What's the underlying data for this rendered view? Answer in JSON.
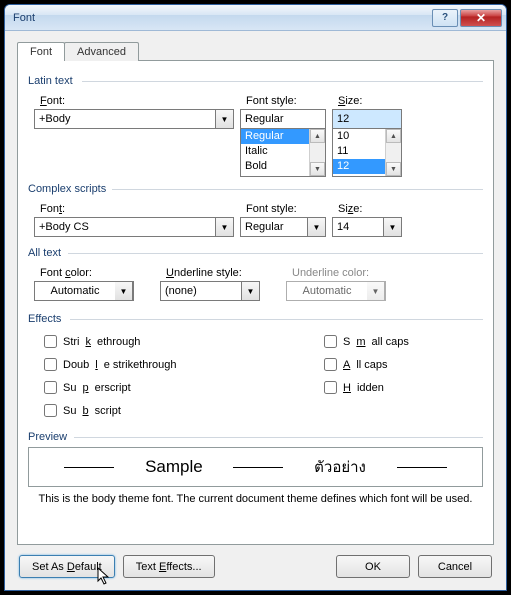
{
  "title": "Font",
  "tabs": {
    "font": "Font",
    "advanced": "Advanced"
  },
  "latin": {
    "section": "Latin text",
    "font_label": "Font:",
    "font_value": "+Body",
    "style_label": "Font style:",
    "style_value": "Regular",
    "style_options": [
      "Regular",
      "Italic",
      "Bold"
    ],
    "size_label": "Size:",
    "size_value": "12",
    "size_options": [
      "10",
      "11",
      "12"
    ]
  },
  "complex": {
    "section": "Complex scripts",
    "font_label": "Font:",
    "font_value": "+Body CS",
    "style_label": "Font style:",
    "style_value": "Regular",
    "size_label": "Size:",
    "size_value": "14"
  },
  "alltext": {
    "section": "All text",
    "fontcolor_label": "Font color:",
    "fontcolor_value": "Automatic",
    "underline_label": "Underline style:",
    "underline_value": "(none)",
    "ucolor_label": "Underline color:",
    "ucolor_value": "Automatic"
  },
  "effects": {
    "section": "Effects",
    "strike": "Strikethrough",
    "dstrike": "Double strikethrough",
    "super": "Superscript",
    "sub": "Subscript",
    "smallcaps": "Small caps",
    "allcaps": "All caps",
    "hidden": "Hidden"
  },
  "preview": {
    "section": "Preview",
    "sample": "Sample",
    "sample_cs": "ตัวอย่าง",
    "hint": "This is the body theme font. The current document theme defines which font will be used."
  },
  "buttons": {
    "default": "Set As Default",
    "texteffects": "Text Effects...",
    "ok": "OK",
    "cancel": "Cancel"
  }
}
